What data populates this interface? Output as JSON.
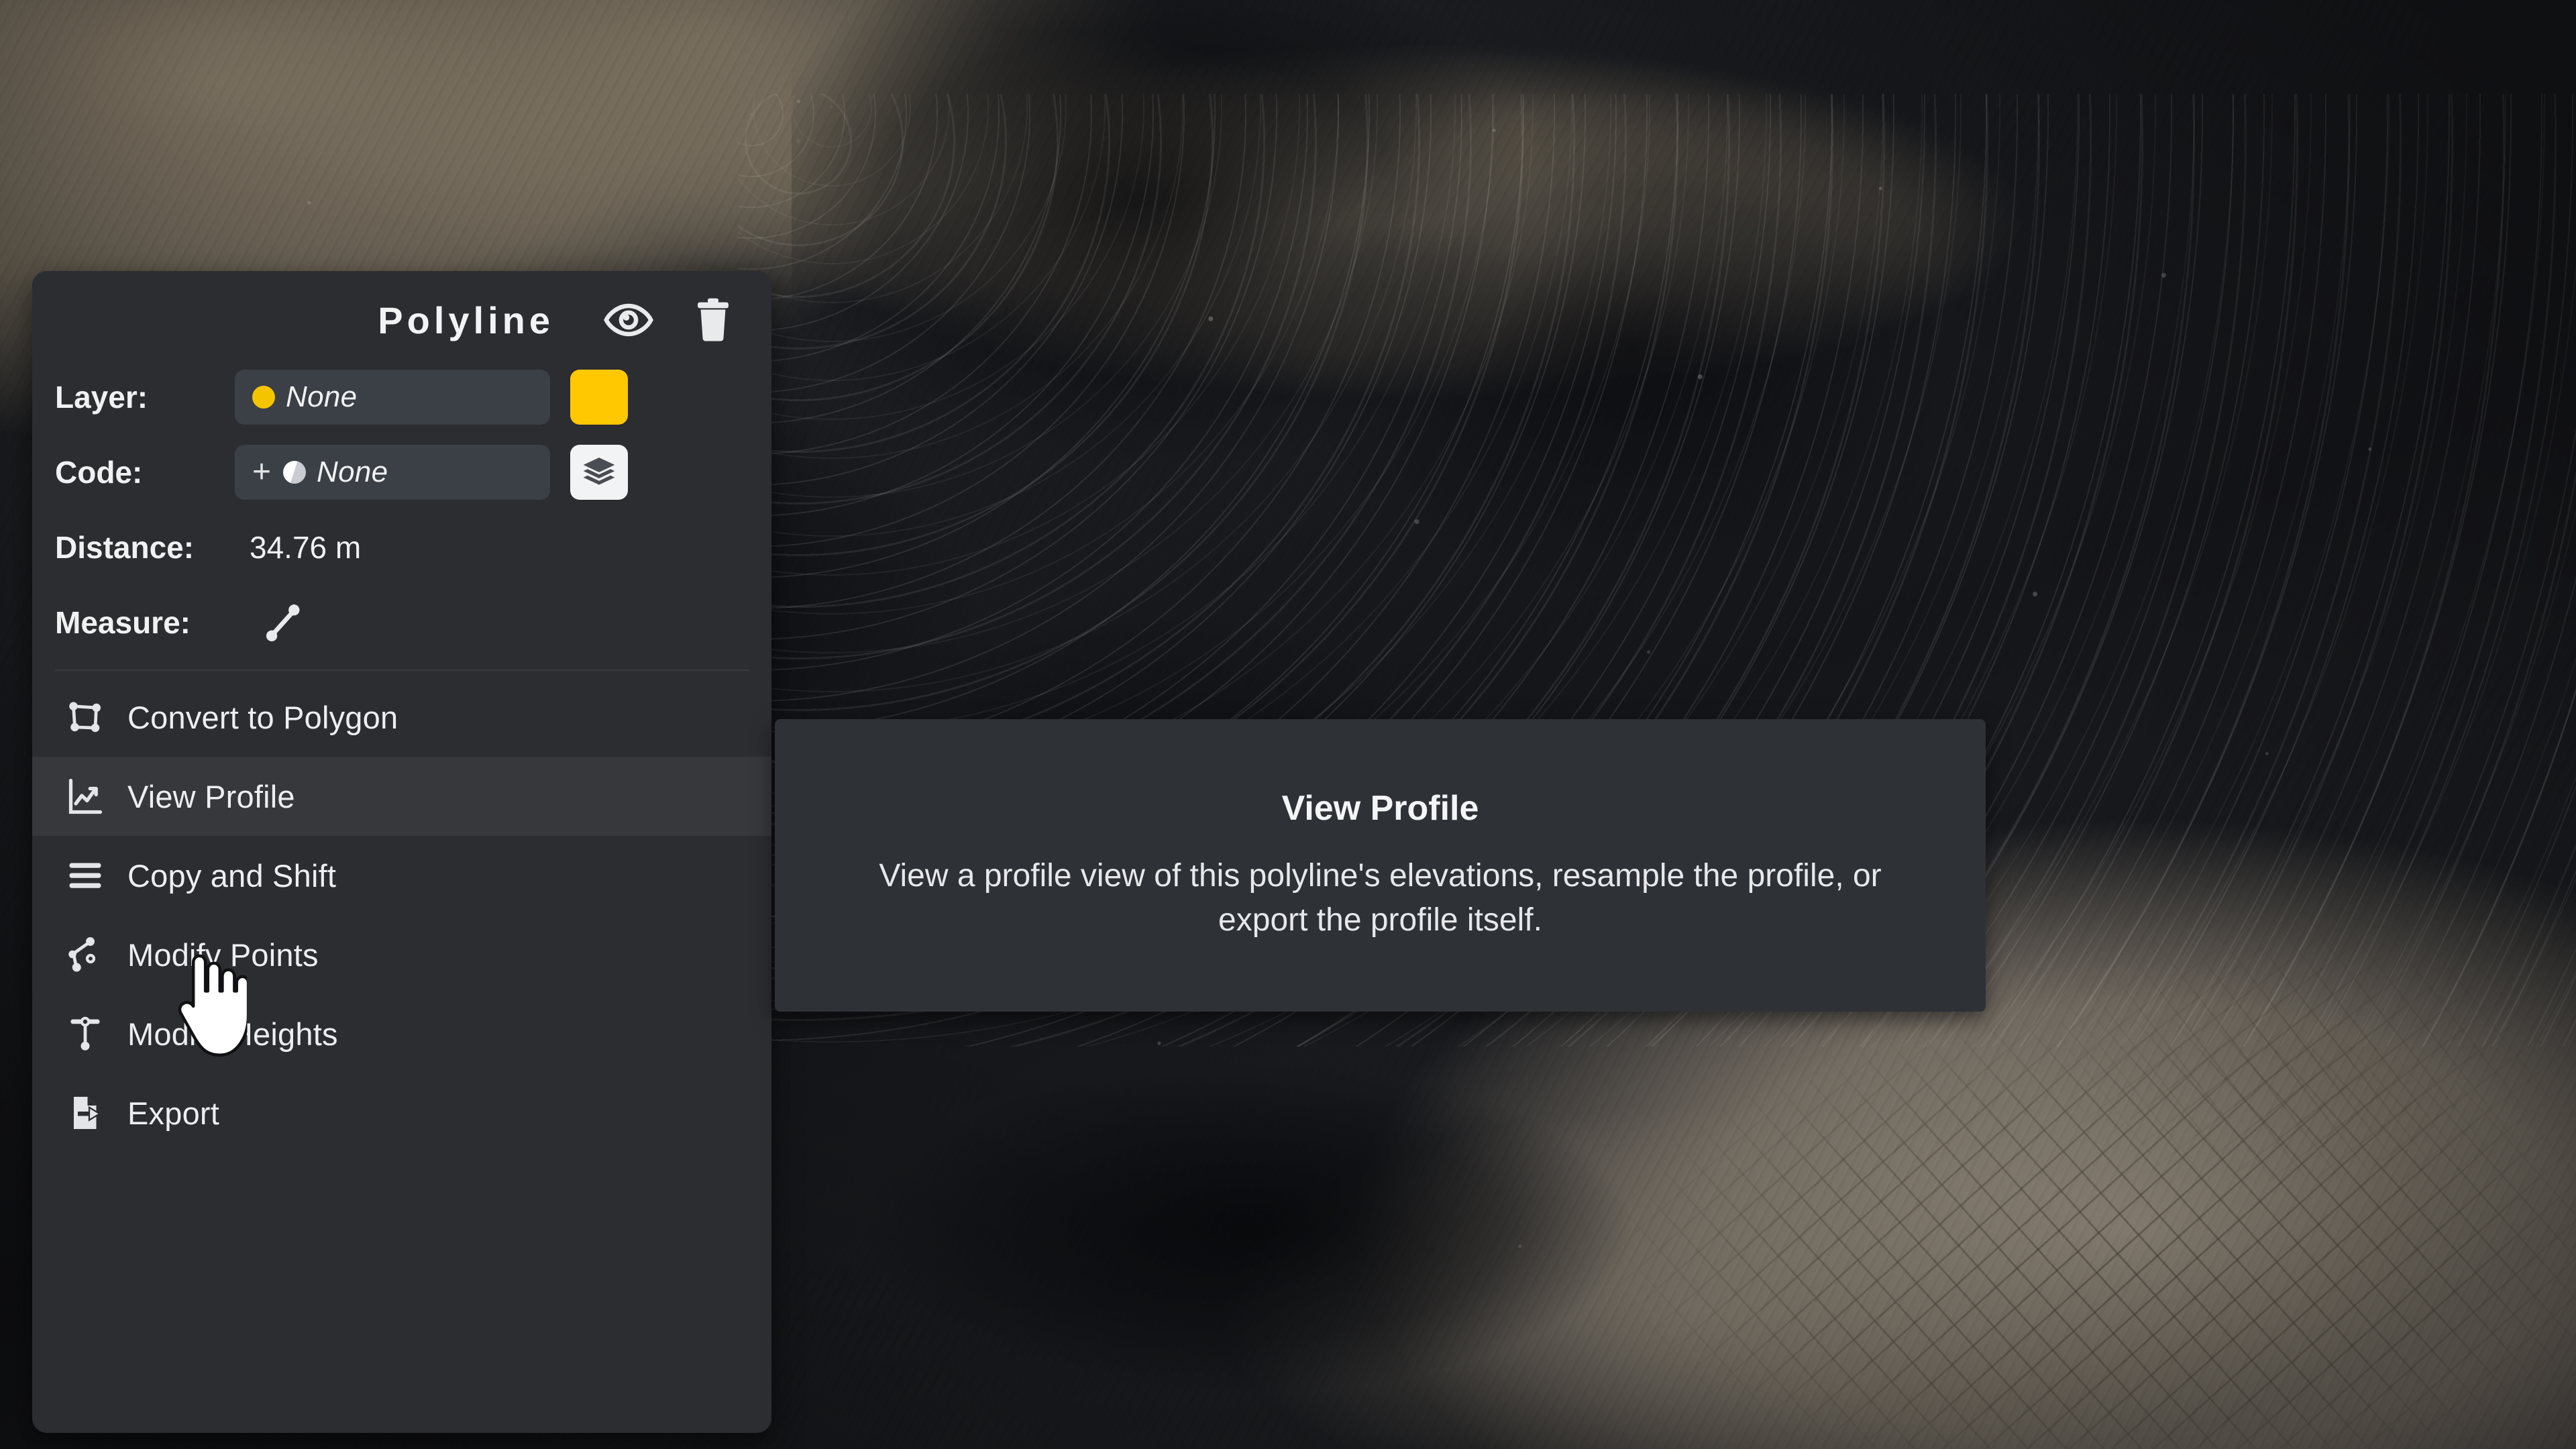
{
  "panel": {
    "title": "Polyline",
    "header_icons": [
      {
        "name": "visibility-eye-icon",
        "label": "Toggle Visibility"
      },
      {
        "name": "delete-trash-icon",
        "label": "Delete"
      }
    ],
    "fields": [
      {
        "label": "Layer:",
        "value": "None",
        "dot": "yellow",
        "trailing": "color-swatch",
        "swatch_color": "#ffc800"
      },
      {
        "label": "Code:",
        "value": "None",
        "prefix": "+",
        "dot": "half",
        "trailing": "layers-button"
      }
    ],
    "readouts": [
      {
        "label": "Distance:",
        "value": "34.76 m"
      },
      {
        "label": "Measure:",
        "value": "",
        "icon": "measure-segment-icon"
      }
    ],
    "menu": [
      {
        "label": "Convert to Polygon",
        "icon": "polygon-nodes-icon",
        "active": false
      },
      {
        "label": "View Profile",
        "icon": "profile-chart-icon",
        "active": true
      },
      {
        "label": "Copy and Shift",
        "icon": "stacked-lines-icon",
        "active": false
      },
      {
        "label": "Modify Points",
        "icon": "points-graph-icon",
        "active": false
      },
      {
        "label": "Modify Heights",
        "icon": "heights-tee-icon",
        "active": false
      },
      {
        "label": "Export",
        "icon": "export-file-icon",
        "active": false
      }
    ]
  },
  "tooltip": {
    "title": "View Profile",
    "body": "View a profile view of this polyline's elevations, resample the profile, or export the profile itself."
  },
  "colors": {
    "panel_background": "#2b2d31",
    "field_background": "#3b3f46",
    "accent_yellow": "#ffc800",
    "text_primary": "#f0f1f2",
    "tooltip_background": "#2e3136",
    "highlight_row": "rgba(255,255,255,0.055)"
  },
  "cursor": {
    "type": "pointing-hand"
  }
}
